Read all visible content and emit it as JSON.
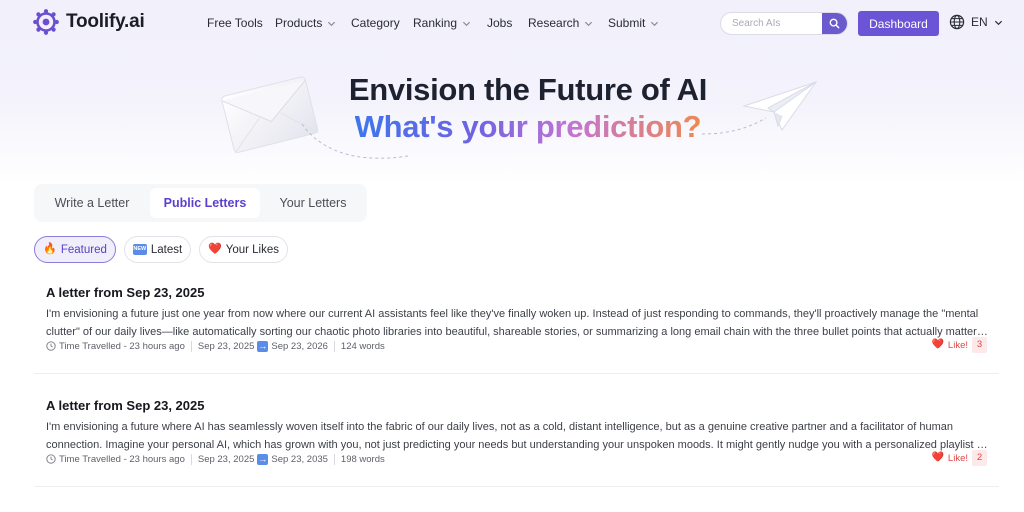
{
  "brand": {
    "name": "Toolify.ai"
  },
  "nav": {
    "items": [
      {
        "label": "Free Tools",
        "has_dropdown": false
      },
      {
        "label": "Products",
        "has_dropdown": true
      },
      {
        "label": "Category",
        "has_dropdown": false
      },
      {
        "label": "Ranking",
        "has_dropdown": true
      },
      {
        "label": "Jobs",
        "has_dropdown": false
      },
      {
        "label": "Research",
        "has_dropdown": true
      },
      {
        "label": "Submit",
        "has_dropdown": true
      }
    ],
    "search": {
      "placeholder": "Search AIs",
      "value": ""
    },
    "dashboard_label": "Dashboard",
    "language": "EN"
  },
  "hero": {
    "title": "Envision the Future of AI",
    "subtitle": "What's your prediction?"
  },
  "tabs": [
    {
      "label": "Write a Letter",
      "active": false
    },
    {
      "label": "Public Letters",
      "active": true
    },
    {
      "label": "Your Letters",
      "active": false
    }
  ],
  "filters": [
    {
      "icon": "fire-icon",
      "glyph": "🔥",
      "label": "Featured",
      "active": true
    },
    {
      "icon": "new-badge-icon",
      "badge_text": "NEW",
      "label": "Latest",
      "active": false
    },
    {
      "icon": "heart-icon",
      "glyph": "❤️",
      "label": "Your Likes",
      "active": false
    }
  ],
  "letters": [
    {
      "title": "A letter from Sep 23, 2025",
      "excerpt": "I'm envisioning a future just one year from now where our current AI assistants feel like they've finally woken up. Instead of just responding to commands, they'll proactively manage the \"mental clutter\" of our daily lives—like automatically sorting our chaotic photo libraries into beautiful, shareable stories, or summarizing a long email chain with the three bullet points that actually matter to you before you even ask.",
      "time_travelled": "Time Travelled - 23 hours ago",
      "from_date": "Sep 23, 2025",
      "to_date": "Sep 23, 2026",
      "words": "124 words",
      "like_label": "Like!",
      "likes": "3"
    },
    {
      "title": "A letter from Sep 23, 2025",
      "excerpt": "I'm envisioning a future where AI has seamlessly woven itself into the fabric of our daily lives, not as a cold, distant intelligence, but as a genuine creative partner and a facilitator of human connection. Imagine your personal AI, which has grown with you, not just predicting your needs but understanding your unspoken moods. It might gently nudge you with a personalized playlist on a tough morning, or suggest reaching out to an old friend.",
      "time_travelled": "Time Travelled - 23 hours ago",
      "from_date": "Sep 23, 2025",
      "to_date": "Sep 23, 2035",
      "words": "198 words",
      "like_label": "Like!",
      "likes": "2"
    }
  ],
  "colors": {
    "accent": "#6b55d6",
    "active_tab_text": "#5b3fd0",
    "like_red": "#e04848",
    "gradient": [
      "#3e76ec",
      "#6f63e2",
      "#c274d4",
      "#ec8a52"
    ]
  }
}
